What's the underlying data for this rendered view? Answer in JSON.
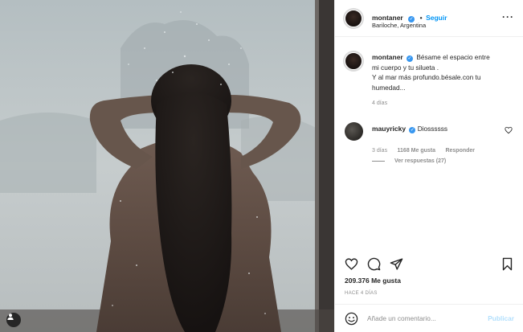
{
  "post": {
    "author": "montaner",
    "follow_label": "Seguir",
    "location": "Bariloche, Argentina",
    "more_icon": "more-horizontal-icon",
    "caption": {
      "username": "montaner",
      "line1": "Bésame el espacio entre",
      "line2": "mi cuerpo y tu silueta .",
      "line3": "Y al mar más profundo.bésale.con tu",
      "line4": "humedad...",
      "time": "4 días"
    },
    "comment": {
      "username": "mauyricky",
      "text": "Diossssss",
      "time": "3 días",
      "likes": "1168 Me gusta",
      "reply_label": "Responder",
      "view_replies": "Ver respuestas (27)"
    },
    "likes_count": "209.376 Me gusta",
    "posted_ago": "HACE 4 DÍAS",
    "comment_placeholder": "Añade un comentario...",
    "publish_label": "Publicar"
  },
  "colors": {
    "accent": "#0095f6",
    "verified": "#3897f0",
    "muted": "#8e8e8e",
    "publish_disabled": "#b2dffc"
  }
}
